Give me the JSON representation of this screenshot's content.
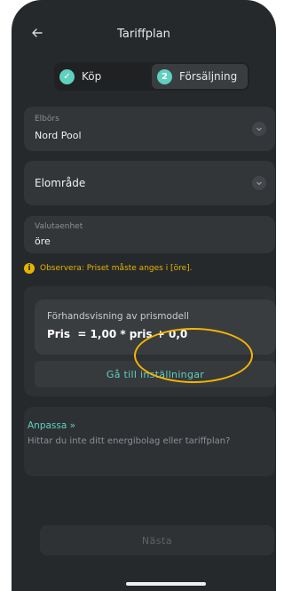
{
  "header": {
    "title": "Tariffplan",
    "back_icon": "arrow-left-icon"
  },
  "steps": [
    {
      "indicator": "✓",
      "label": "Köp",
      "state": "done"
    },
    {
      "indicator": "2",
      "label": "Försäljning",
      "state": "active"
    }
  ],
  "fields": {
    "elbors": {
      "label": "Elbörs",
      "value": "Nord Pool"
    },
    "elomrade": {
      "label": "Elområde",
      "value": ""
    },
    "valuta": {
      "label": "Valutaenhet",
      "value": "öre"
    }
  },
  "note": {
    "icon": "info-icon",
    "text": "Observera: Priset måste anges i [öre]."
  },
  "preview": {
    "heading": "Förhandsvisning av prismodell",
    "formula": "Pris  = 1,00 * pris + 0,0",
    "button": "Gå till inställningar"
  },
  "custom": {
    "link": "Anpassa »",
    "text": "Hittar du inte ditt energibolag eller tariffplan?"
  },
  "footer": {
    "next": "Nästa"
  },
  "colors": {
    "accent": "#5fd0bf",
    "warning": "#e6b400",
    "highlight": "#f7b500",
    "background": "#26292b"
  }
}
